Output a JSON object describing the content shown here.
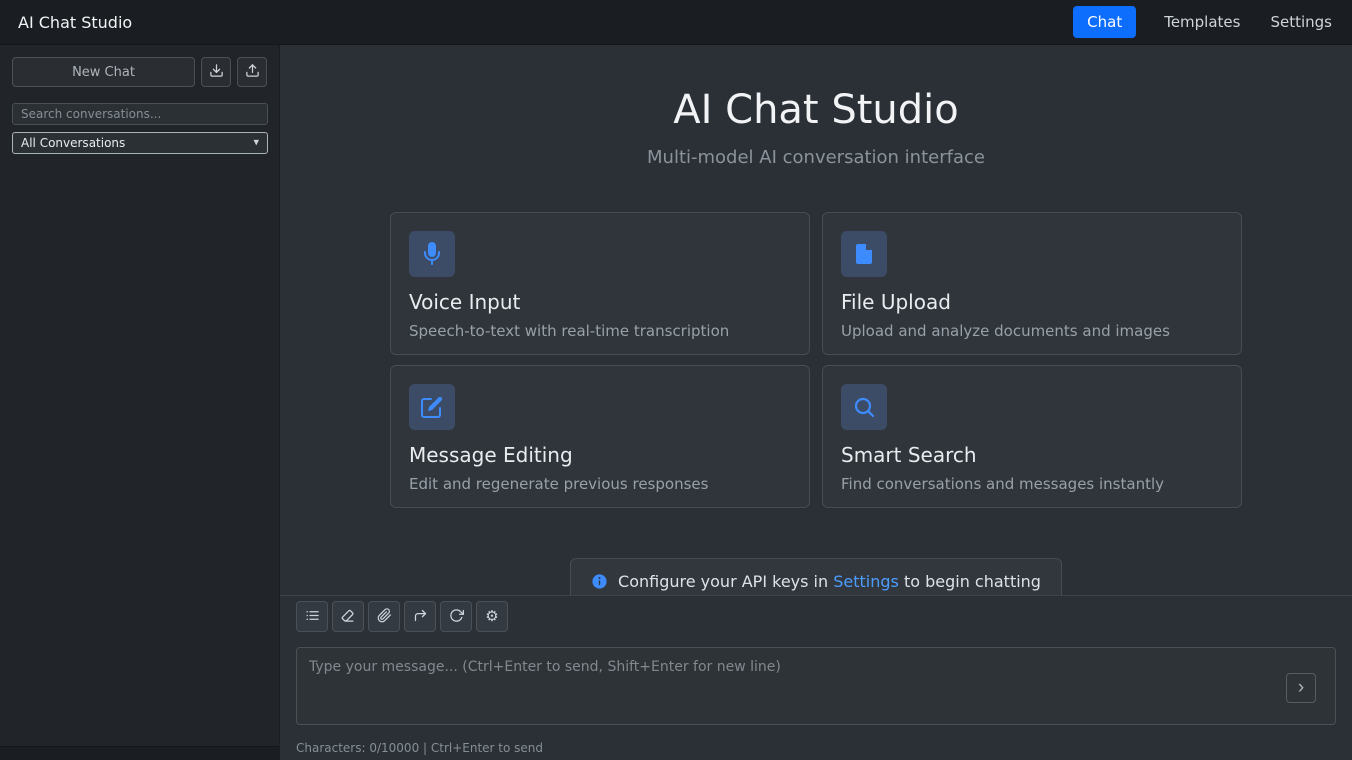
{
  "header": {
    "title": "AI Chat Studio",
    "nav": [
      {
        "label": "Chat",
        "active": true
      },
      {
        "label": "Templates",
        "active": false
      },
      {
        "label": "Settings",
        "active": false
      }
    ]
  },
  "sidebar": {
    "new_chat_label": "New Chat",
    "export_icon": "download-icon",
    "import_icon": "upload-icon",
    "search_placeholder": "Search conversations...",
    "filter_value": "All Conversations"
  },
  "main": {
    "title": "AI Chat Studio",
    "subtitle": "Multi-model AI conversation interface",
    "features": [
      {
        "icon": "microphone-icon",
        "title": "Voice Input",
        "description": "Speech-to-text with real-time transcription"
      },
      {
        "icon": "file-icon",
        "title": "File Upload",
        "description": "Upload and analyze documents and images"
      },
      {
        "icon": "edit-icon",
        "title": "Message Editing",
        "description": "Edit and regenerate previous responses"
      },
      {
        "icon": "search-icon",
        "title": "Smart Search",
        "description": "Find conversations and messages instantly"
      }
    ],
    "banner": {
      "icon": "info-icon",
      "text_before": "Configure your API keys in",
      "link_text": "Settings",
      "text_after": "to begin chatting"
    }
  },
  "composer": {
    "toolbar_icons": [
      "list-icon",
      "eraser-icon",
      "paperclip-icon",
      "forward-icon",
      "refresh-icon",
      "gear-icon"
    ],
    "input_placeholder": "Type your message... (Ctrl+Enter to send, Shift+Enter for new line)",
    "status": "Characters: 0/10000 | Ctrl+Enter to send"
  },
  "icons": {
    "send": "›",
    "select_caret": "▾",
    "gear": "⚙"
  },
  "colors": {
    "accent": "#0d6efd",
    "link": "#4d9dff",
    "icon_blue": "#3d8bfd",
    "header_bg": "#1a1d21",
    "sidebar_bg": "#212529",
    "main_bg": "#2b3036"
  }
}
